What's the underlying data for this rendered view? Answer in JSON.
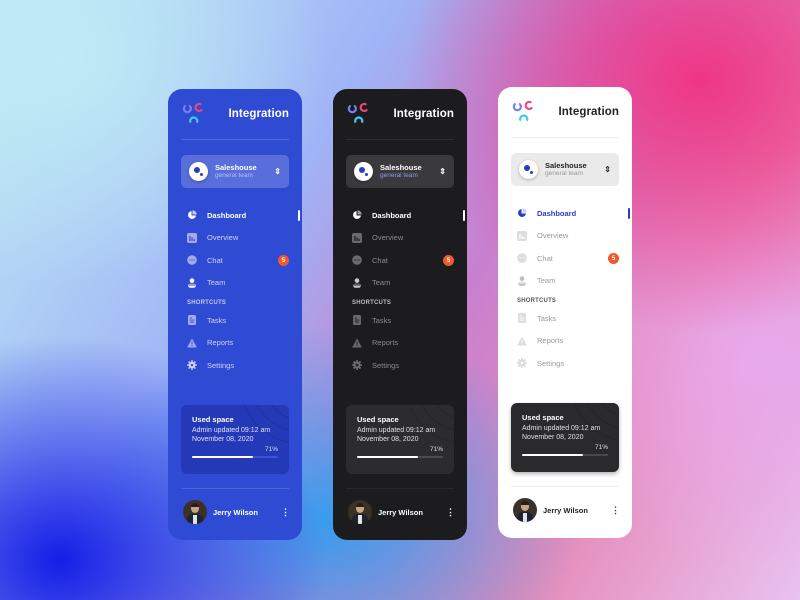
{
  "panels": [
    {
      "theme": "blue",
      "brand": {
        "title": "Integration"
      },
      "workspace": {
        "name": "Saleshouse",
        "subtitle": "general team"
      },
      "nav": [
        {
          "label": "Dashboard",
          "icon": "pie-chart-icon",
          "active": true
        },
        {
          "label": "Overview",
          "icon": "bar-chart-icon"
        },
        {
          "label": "Chat",
          "icon": "chat-icon",
          "badge": "5"
        },
        {
          "label": "Team",
          "icon": "user-icon"
        }
      ],
      "shortcuts_label": "SHORTCUTS",
      "shortcuts": [
        {
          "label": "Tasks",
          "icon": "document-icon"
        },
        {
          "label": "Reports",
          "icon": "warning-icon"
        },
        {
          "label": "Settings",
          "icon": "gear-icon"
        }
      ],
      "storage": {
        "title": "Used space",
        "line1": "Admin updated 09:12 am",
        "line2": "November 08, 2020",
        "percent_label": "71%",
        "percent": 71
      },
      "user": {
        "name": "Jerry Wilson",
        "menu_icon": "⋮"
      }
    },
    {
      "theme": "dark",
      "brand": {
        "title": "Integration"
      },
      "workspace": {
        "name": "Saleshouse",
        "subtitle": "general team"
      },
      "nav": [
        {
          "label": "Dashboard",
          "icon": "pie-chart-icon",
          "active": true
        },
        {
          "label": "Overview",
          "icon": "bar-chart-icon"
        },
        {
          "label": "Chat",
          "icon": "chat-icon",
          "badge": "5"
        },
        {
          "label": "Team",
          "icon": "user-icon"
        }
      ],
      "shortcuts_label": "SHORTCUTS",
      "shortcuts": [
        {
          "label": "Tasks",
          "icon": "document-icon"
        },
        {
          "label": "Reports",
          "icon": "warning-icon"
        },
        {
          "label": "Settings",
          "icon": "gear-icon"
        }
      ],
      "storage": {
        "title": "Used space",
        "line1": "Admin updated 09:12 am",
        "line2": "November 08, 2020",
        "percent_label": "71%",
        "percent": 71
      },
      "user": {
        "name": "Jerry Wilson",
        "menu_icon": "⋮"
      }
    },
    {
      "theme": "light",
      "brand": {
        "title": "Integration"
      },
      "workspace": {
        "name": "Saleshouse",
        "subtitle": "general team"
      },
      "nav": [
        {
          "label": "Dashboard",
          "icon": "pie-chart-icon",
          "active": true
        },
        {
          "label": "Overview",
          "icon": "bar-chart-icon"
        },
        {
          "label": "Chat",
          "icon": "chat-icon",
          "badge": "5"
        },
        {
          "label": "Team",
          "icon": "user-icon"
        }
      ],
      "shortcuts_label": "SHORTCUTS",
      "shortcuts": [
        {
          "label": "Tasks",
          "icon": "document-icon"
        },
        {
          "label": "Reports",
          "icon": "warning-icon"
        },
        {
          "label": "Settings",
          "icon": "gear-icon"
        }
      ],
      "storage": {
        "title": "Used space",
        "line1": "Admin updated 09:12 am",
        "line2": "November 08, 2020",
        "percent_label": "71%",
        "percent": 71
      },
      "user": {
        "name": "Jerry Wilson",
        "menu_icon": "⋮"
      }
    }
  ],
  "colors": {
    "blue_panel": "#2f4ad3",
    "dark_panel": "#1c1c1e",
    "light_panel": "#ffffff",
    "accent": "#2a3bc7",
    "badge": "#f05a2f",
    "logo_purple": "#7b7ef0",
    "logo_pink": "#f0457a",
    "logo_cyan": "#3fc8f0"
  },
  "workspace_chevron": "⇕"
}
